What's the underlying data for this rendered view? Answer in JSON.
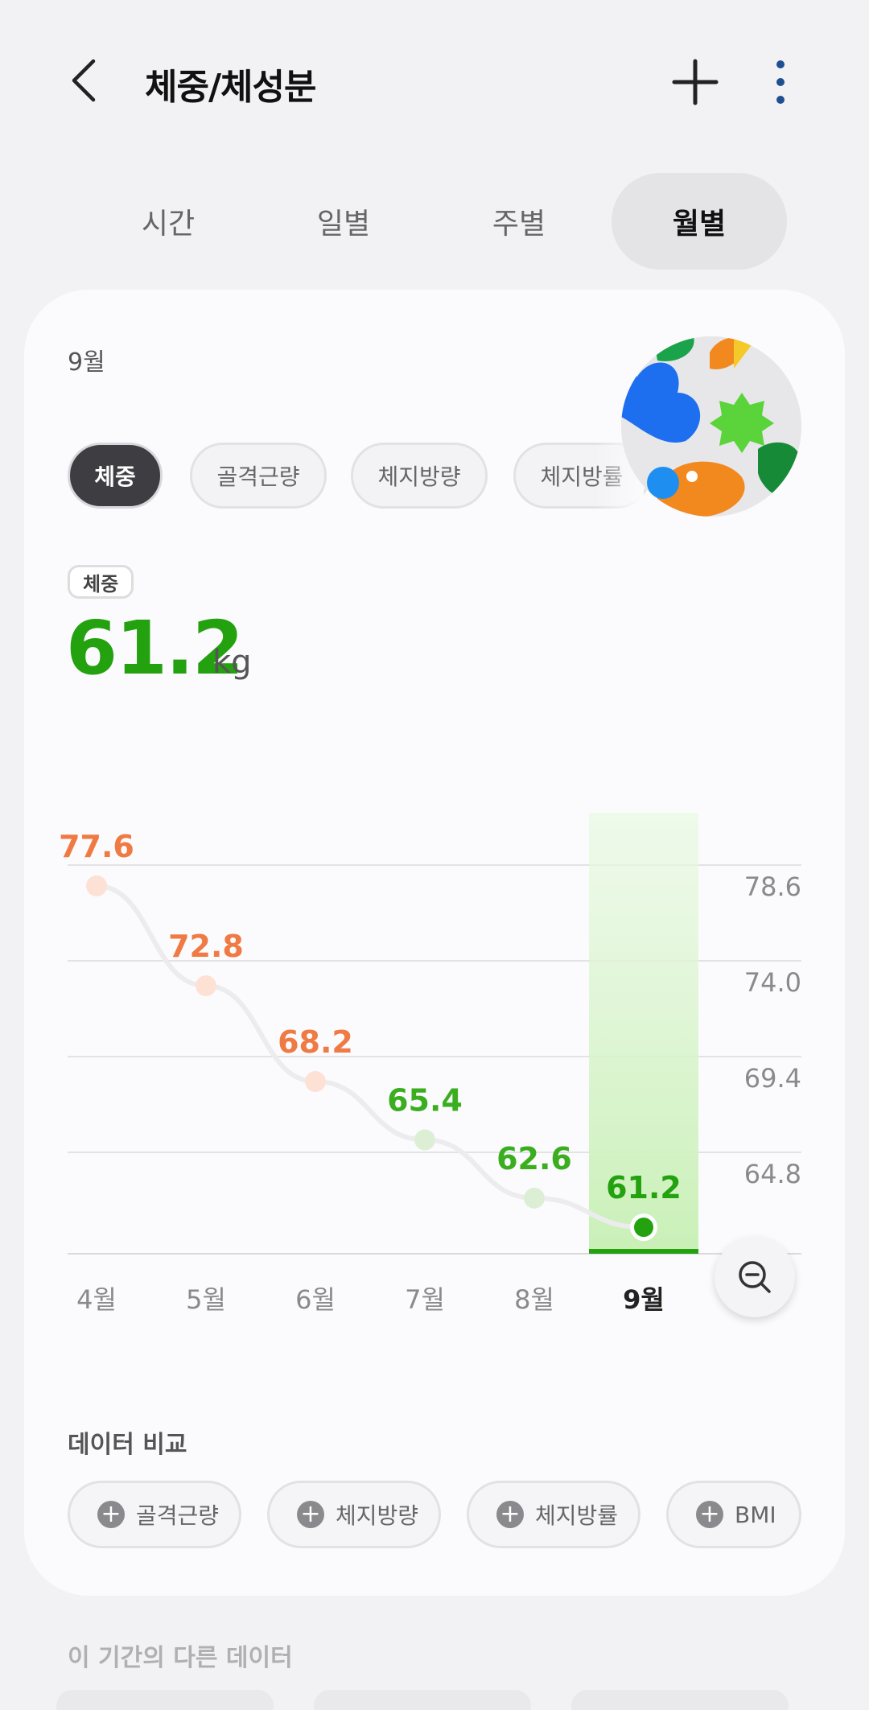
{
  "header": {
    "title": "체중/체성분",
    "back_icon": "chevron-left-icon",
    "add_icon": "plus-icon",
    "more_icon": "more-vertical-icon"
  },
  "tabs": [
    {
      "label": "시간"
    },
    {
      "label": "일별"
    },
    {
      "label": "주별"
    },
    {
      "label": "월별",
      "active": true
    }
  ],
  "period_label": "9월",
  "metric_chips": [
    {
      "label": "체중",
      "active": true
    },
    {
      "label": "골격근량"
    },
    {
      "label": "체지방량"
    },
    {
      "label": "체지방률"
    }
  ],
  "summary": {
    "badge": "체중",
    "value": "61.2",
    "unit": "kg",
    "color": "#24a10f"
  },
  "chart_data": {
    "type": "line",
    "categories": [
      "4월",
      "5월",
      "6월",
      "7월",
      "8월",
      "9월"
    ],
    "values": [
      77.6,
      72.8,
      68.2,
      65.4,
      62.6,
      61.2
    ],
    "value_labels": [
      "77.6",
      "72.8",
      "68.2",
      "65.4",
      "62.6",
      "61.2"
    ],
    "y_ticks": [
      "78.6",
      "74.0",
      "69.4",
      "64.8"
    ],
    "selected_index": 5,
    "colors": {
      "above": "#ef7a43",
      "below": "#3aae1f",
      "selected": "#24a10f"
    }
  },
  "zoom_icon": "zoom-out-icon",
  "compare": {
    "title": "데이터 비교",
    "items": [
      "골격근량",
      "체지방량",
      "체지방률",
      "BMI"
    ]
  },
  "other_section_title": "이 기간의 다른 데이터"
}
